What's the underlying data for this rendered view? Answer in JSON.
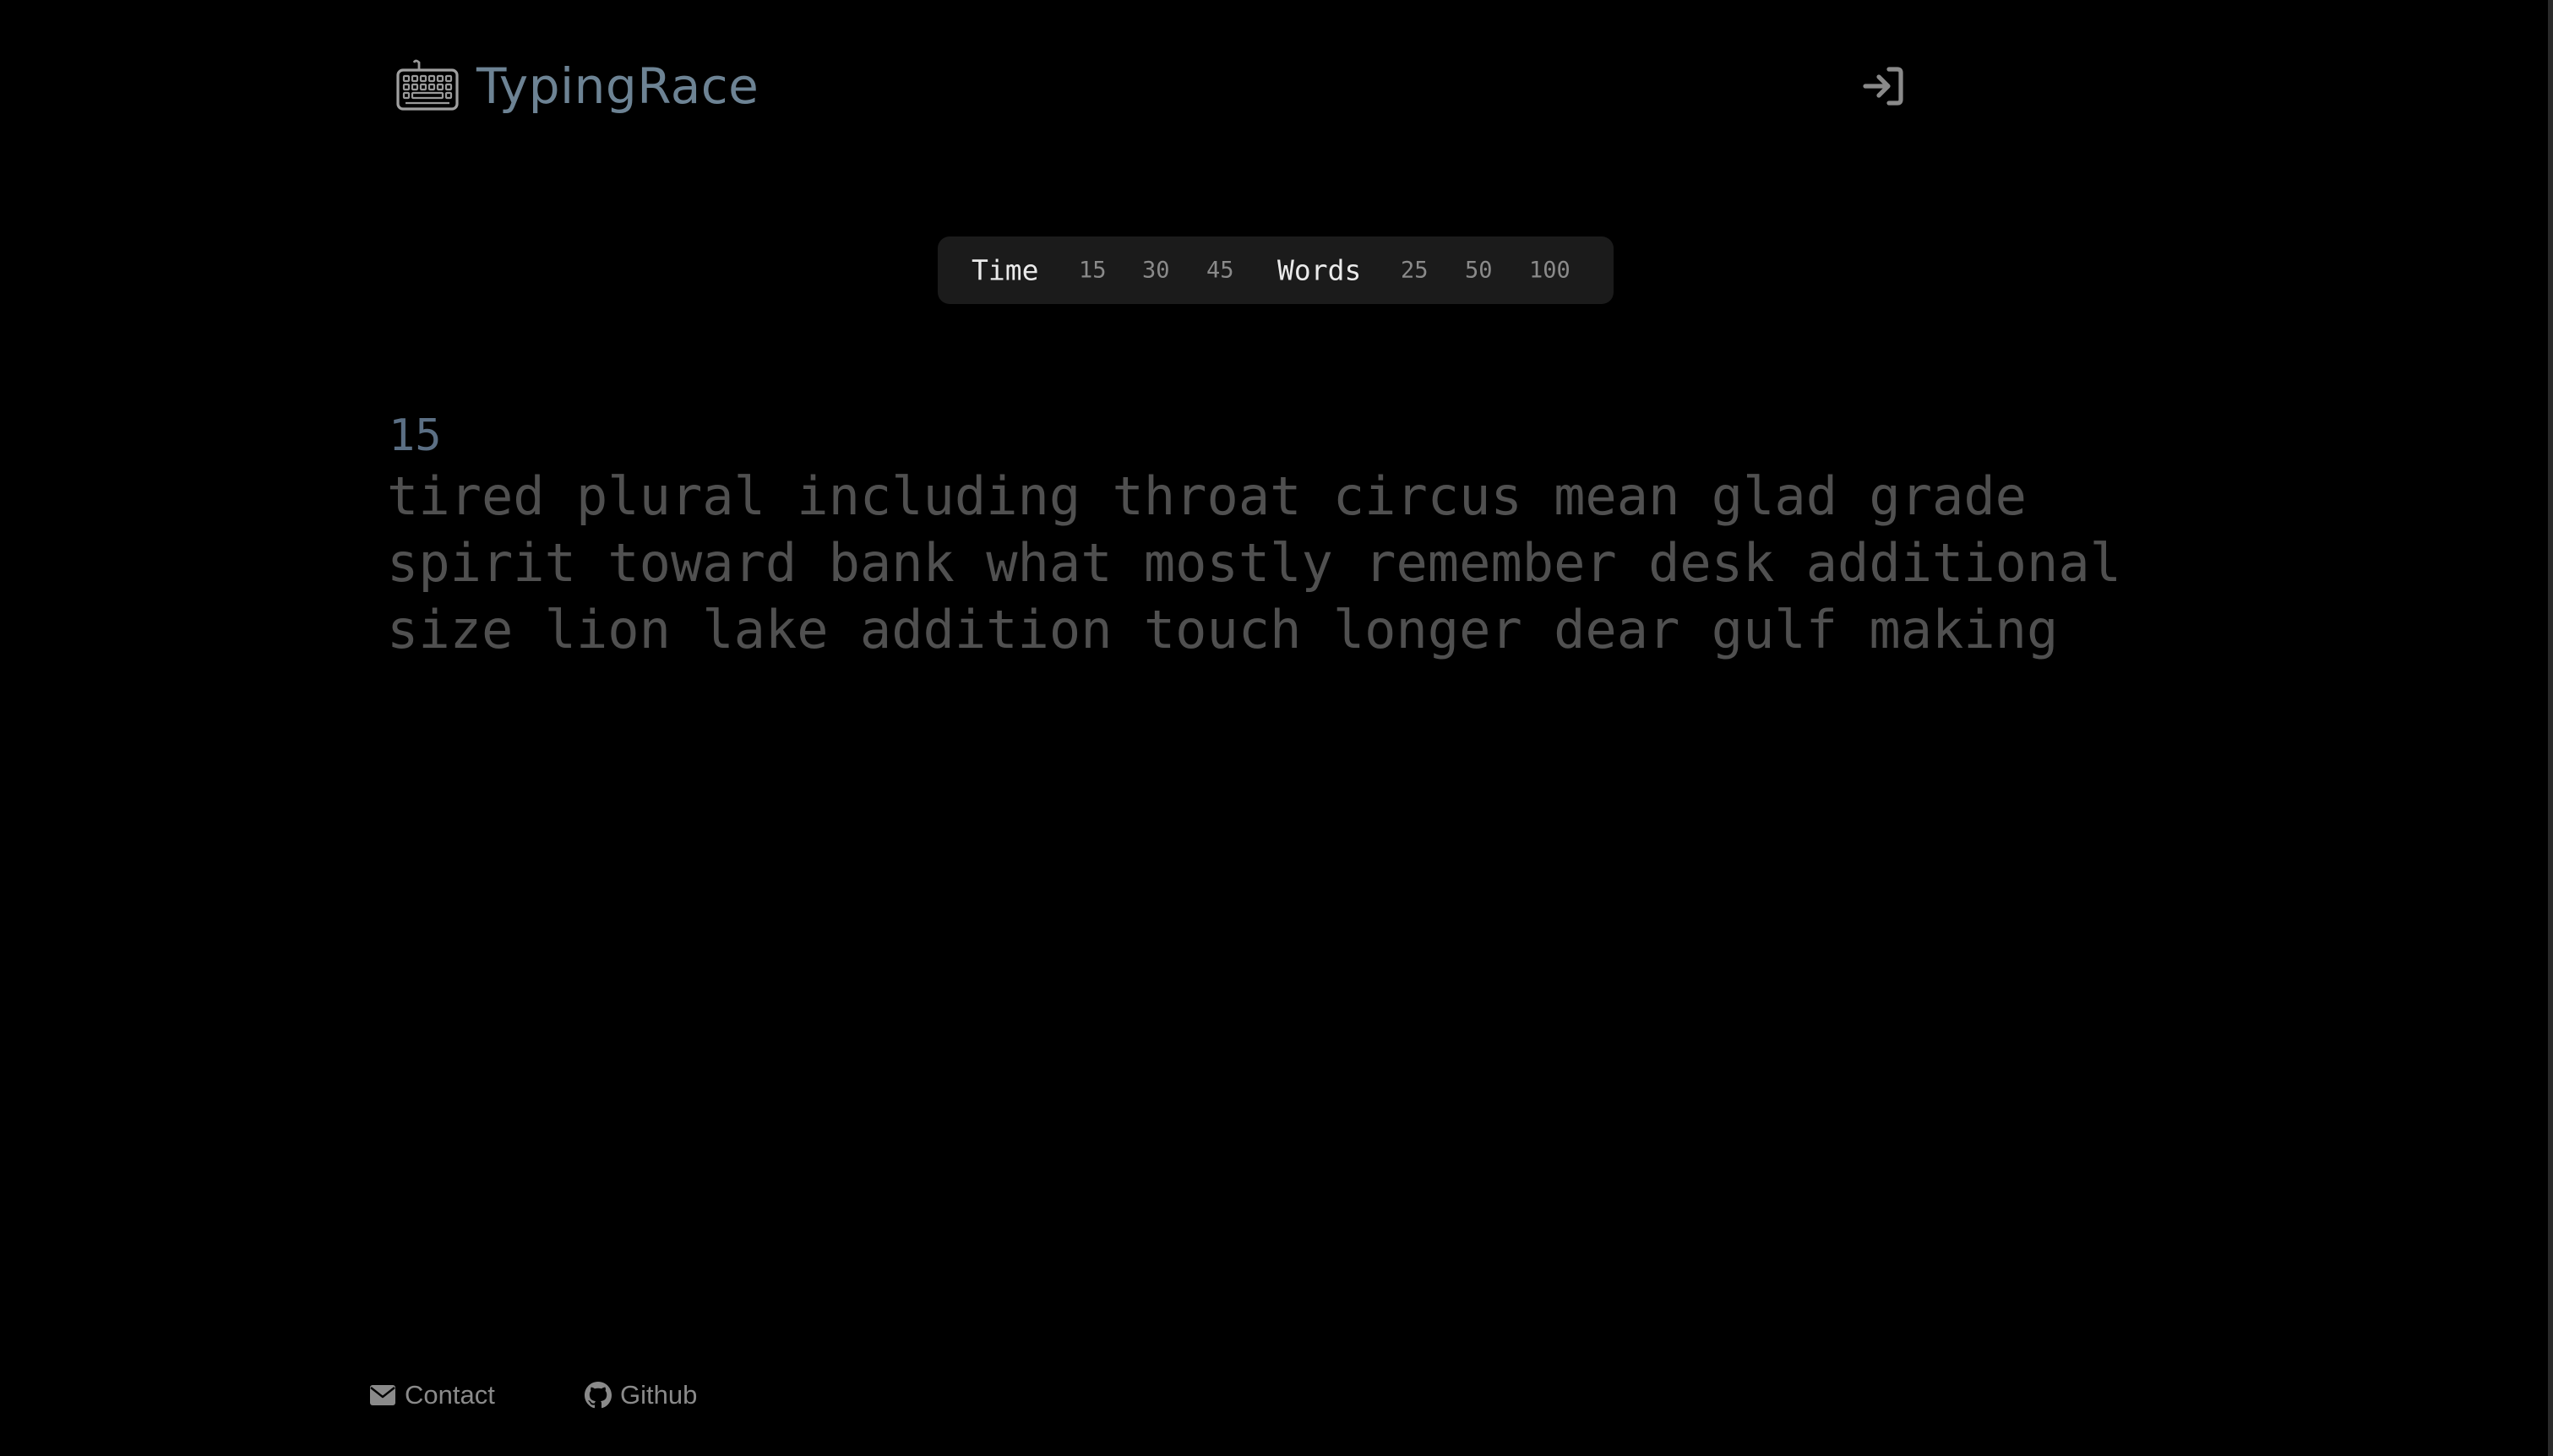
{
  "header": {
    "brand_title": "TypingRace",
    "logo_icon": "keyboard-icon",
    "login_icon": "sign-in-icon",
    "brand_color": "#6d8394"
  },
  "mode_bar": {
    "time_label": "Time",
    "time_options": [
      "15",
      "30",
      "45"
    ],
    "words_label": "Words",
    "words_options": [
      "25",
      "50",
      "100"
    ]
  },
  "test": {
    "countdown": "15",
    "lines": [
      "tired plural including throat circus mean glad grade",
      "spirit toward bank what mostly remember desk additional",
      "size lion lake addition touch longer dear gulf making"
    ],
    "text_color": "#505050",
    "countdown_color": "#5b6f84"
  },
  "footer": {
    "contact_label": "Contact",
    "contact_icon": "envelope-icon",
    "github_label": "Github",
    "github_icon": "github-icon"
  }
}
